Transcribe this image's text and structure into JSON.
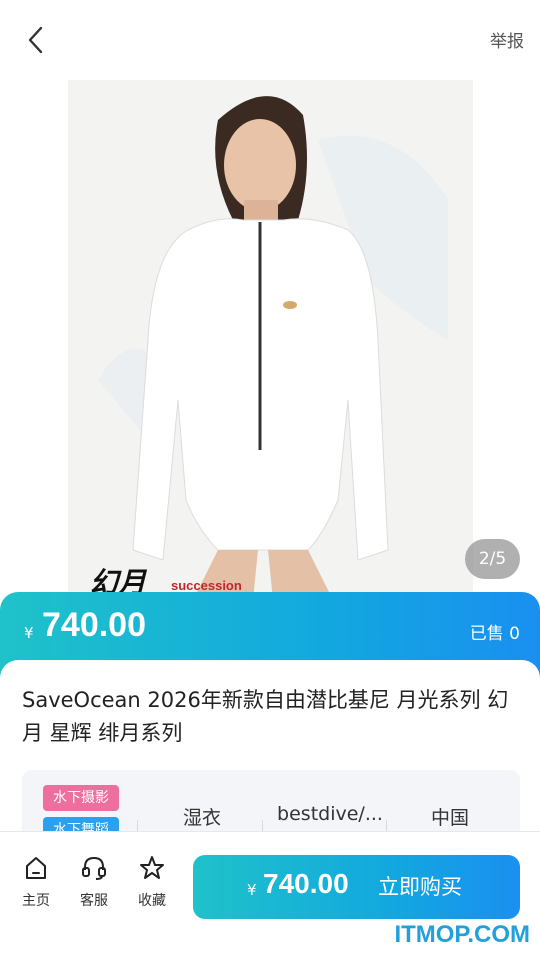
{
  "header": {
    "back_icon": "chevron-left-icon",
    "report_label": "举报"
  },
  "gallery": {
    "image_text": "幻月",
    "image_subtext": "succession",
    "page_indicator": "2/5"
  },
  "price_banner": {
    "currency": "¥",
    "price": "740.00",
    "sold": "已售 0"
  },
  "product": {
    "title": "SaveOcean 2026年新款自由潜比基尼 月光系列 幻月 星辉 绯月系列",
    "tags": [
      "水下摄影",
      "水下舞蹈"
    ],
    "attributes": [
      "湿衣",
      "bestdive/...",
      "中国"
    ]
  },
  "bottom_bar": {
    "nav": [
      {
        "label": "主页",
        "icon": "home-icon"
      },
      {
        "label": "客服",
        "icon": "headset-icon"
      },
      {
        "label": "收藏",
        "icon": "star-icon"
      }
    ],
    "buy": {
      "currency": "¥",
      "price": "740.00",
      "label": "立即购买"
    }
  },
  "watermark": "ITMOP.COM",
  "colors": {
    "accent_start": "#1fc2c9",
    "accent_end": "#1a8ff0",
    "tag_pink": "#ec6f9d",
    "tag_blue": "#2aa0ee"
  }
}
